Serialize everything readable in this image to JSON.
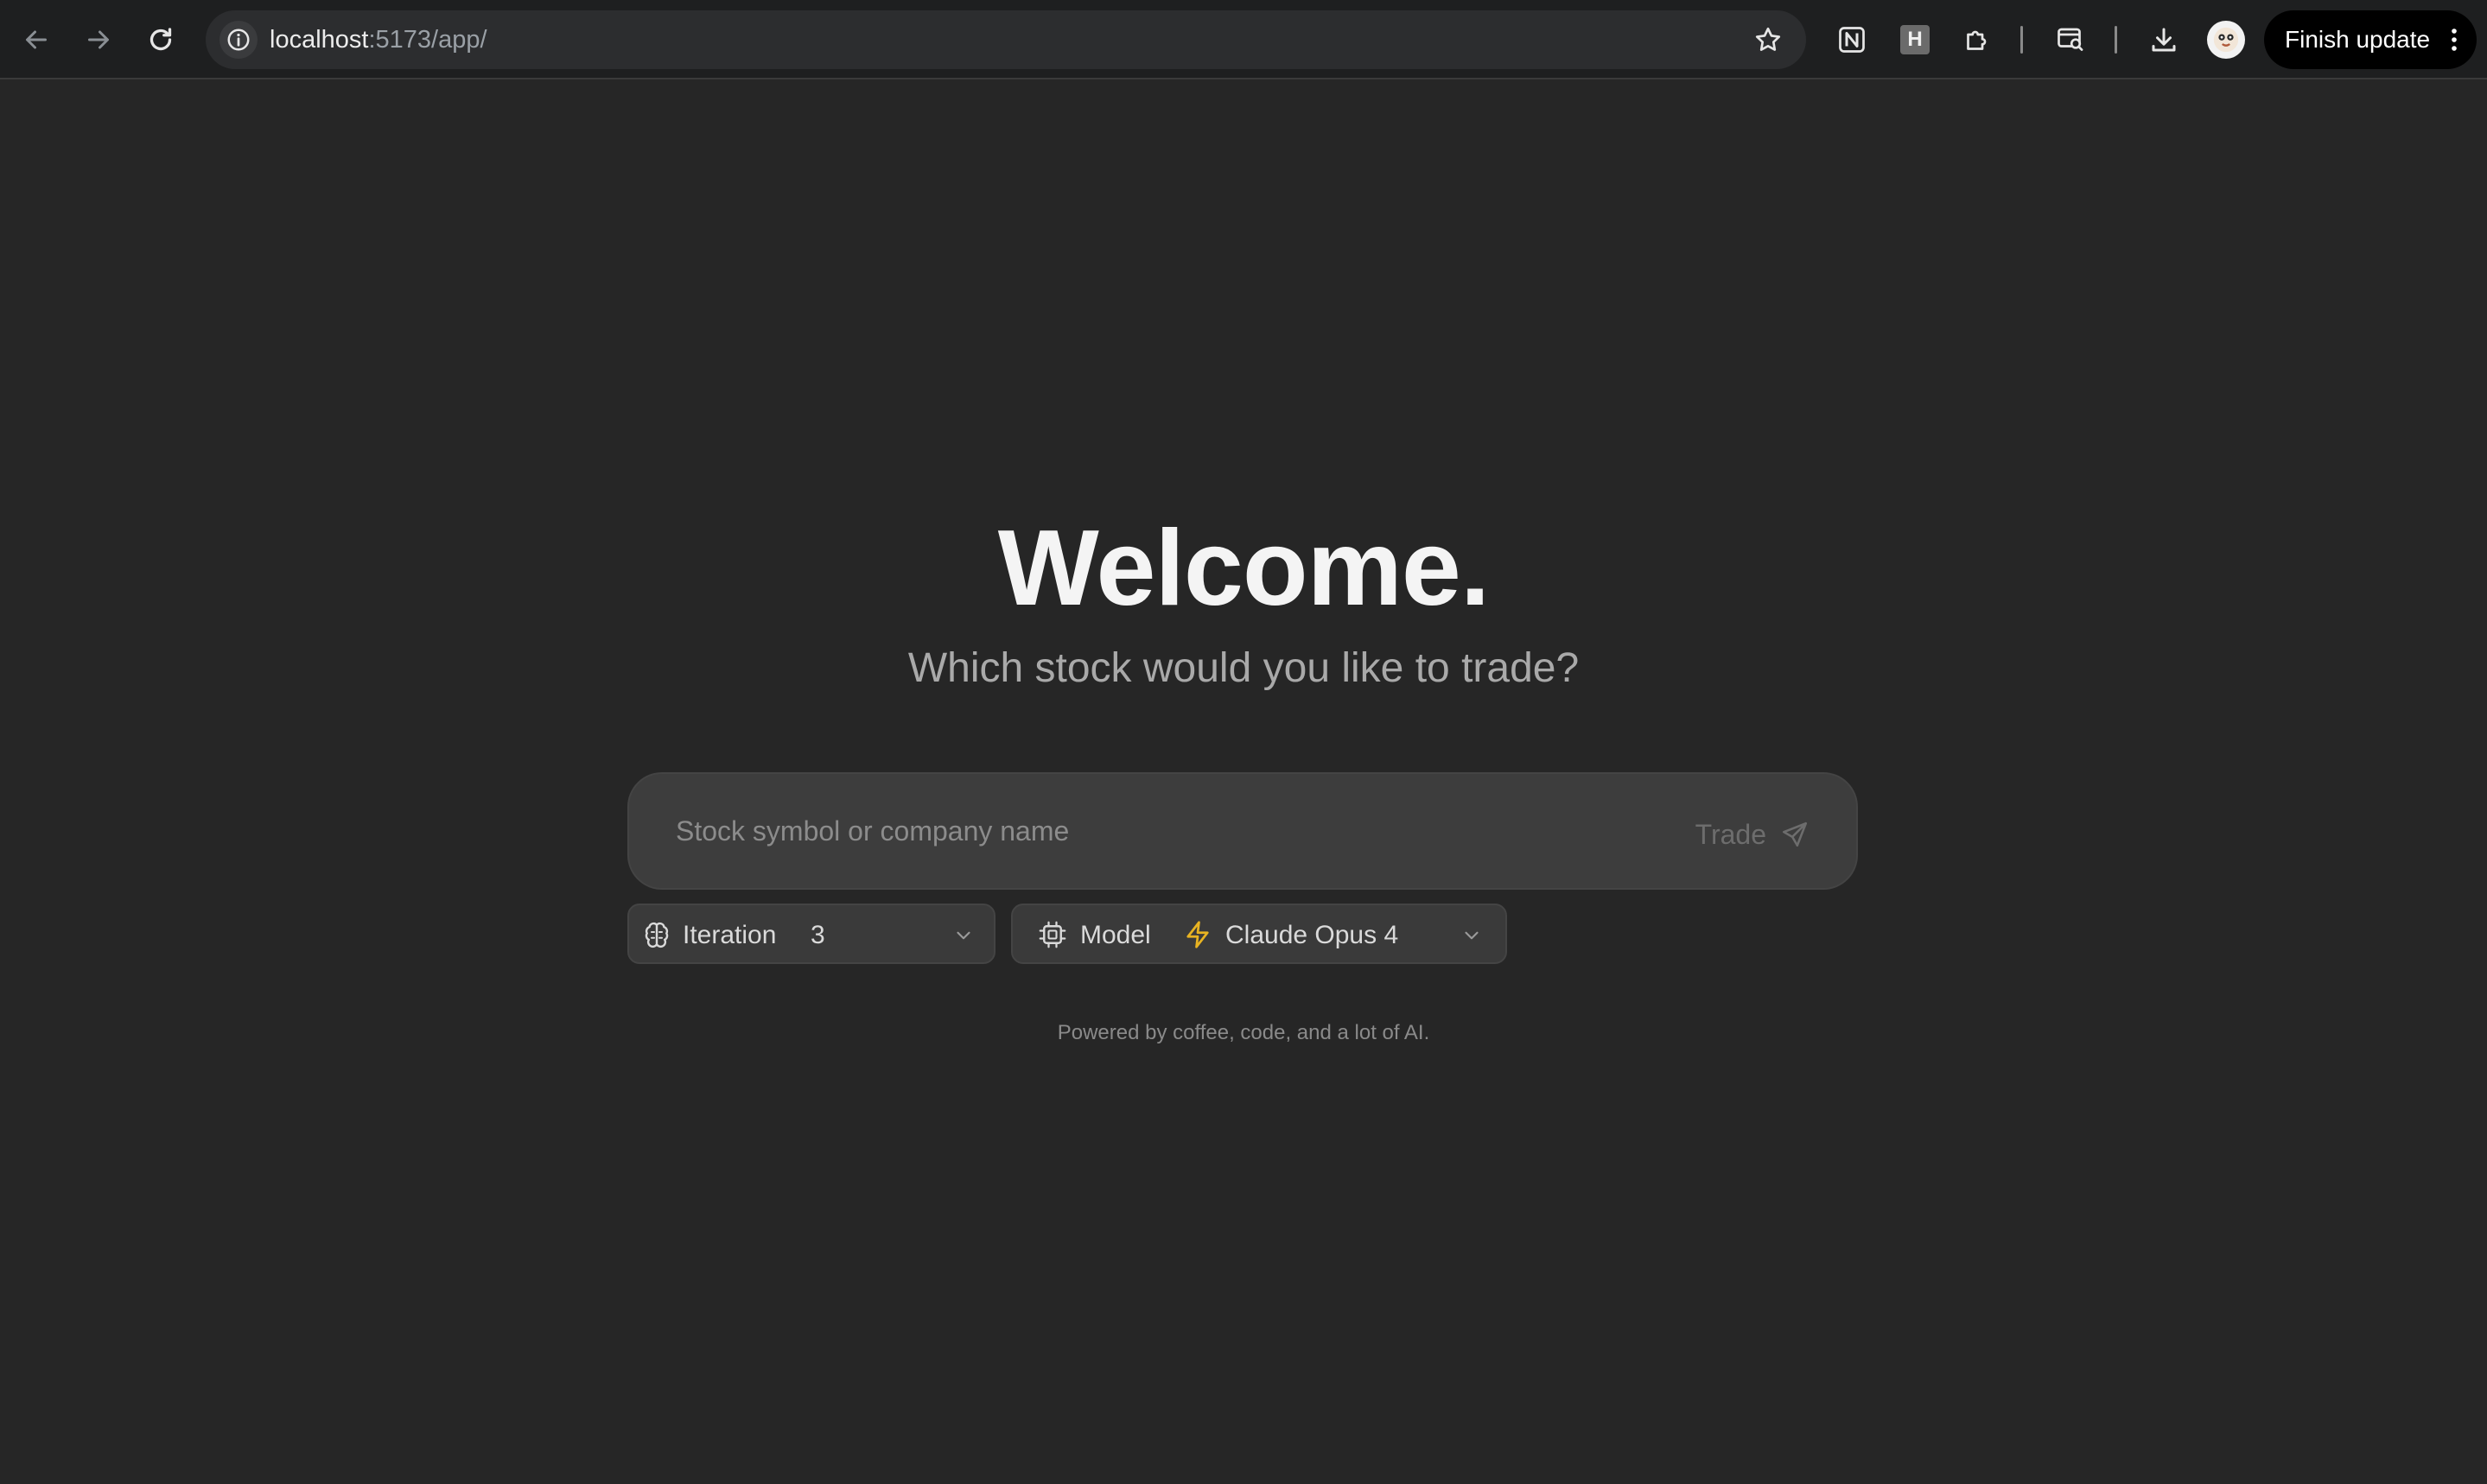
{
  "browser": {
    "url_host": "localhost",
    "url_rest": ":5173/app/",
    "extension_h_label": "H",
    "finish_update_label": "Finish update"
  },
  "page": {
    "title": "Welcome.",
    "subtitle": "Which stock would you like to trade?",
    "search_placeholder": "Stock symbol or company name",
    "trade_label": "Trade",
    "iteration_label": "Iteration",
    "iteration_value": "3",
    "model_label": "Model",
    "model_value": "Claude Opus 4",
    "footer": "Powered by coffee, code, and a lot of AI."
  },
  "colors": {
    "background": "#262626",
    "input_background": "#3d3d3d",
    "accent_bolt": "#e8b322"
  }
}
